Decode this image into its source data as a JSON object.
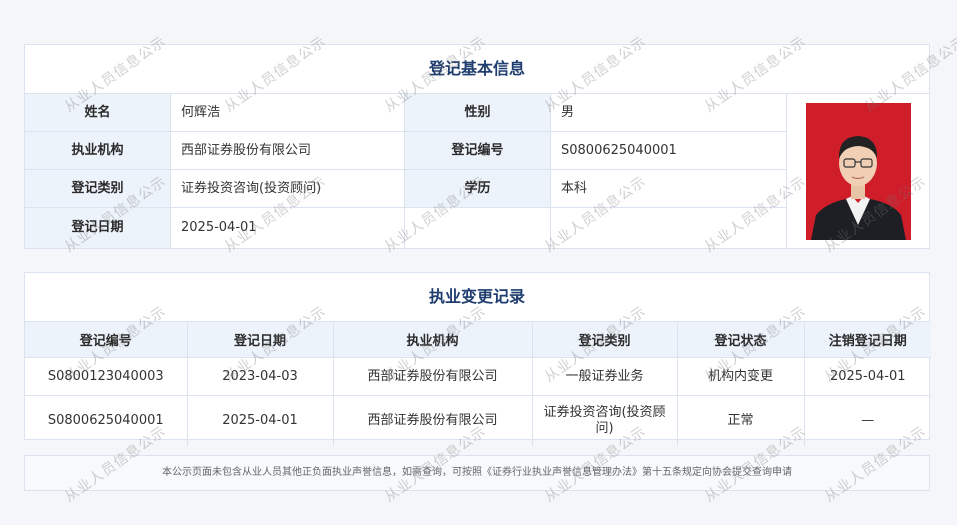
{
  "basic_info": {
    "title": "登记基本信息",
    "name_label": "姓名",
    "name_value": "何辉浩",
    "gender_label": "性别",
    "gender_value": "男",
    "org_label": "执业机构",
    "org_value": "西部证券股份有限公司",
    "reg_no_label": "登记编号",
    "reg_no_value": "S0800625040001",
    "reg_type_label": "登记类别",
    "reg_type_value": "证券投资咨询(投资顾问)",
    "edu_label": "学历",
    "edu_value": "本科",
    "reg_date_label": "登记日期",
    "reg_date_value": "2025-04-01",
    "photo_bg_color": "#cf1d2a"
  },
  "history": {
    "title": "执业变更记录",
    "columns": [
      "登记编号",
      "登记日期",
      "执业机构",
      "登记类别",
      "登记状态",
      "注销登记日期"
    ],
    "rows": [
      [
        "S0800123040003",
        "2023-04-03",
        "西部证券股份有限公司",
        "一般证券业务",
        "机构内变更",
        "2025-04-01"
      ],
      [
        "S0800625040001",
        "2025-04-01",
        "西部证券股份有限公司",
        "证券投资咨询(投资顾问)",
        "正常",
        "—"
      ]
    ]
  },
  "notice": "本公示页面未包含从业人员其他正负面执业声誉信息，如需查询，可按照《证券行业执业声誉信息管理办法》第十五条规定向协会提交查询申请",
  "watermark": "从业人员信息公示",
  "colors": {
    "title_text": "#1f3d6e",
    "label_bg": "#edf3fb",
    "border": "#dbe3ee"
  }
}
